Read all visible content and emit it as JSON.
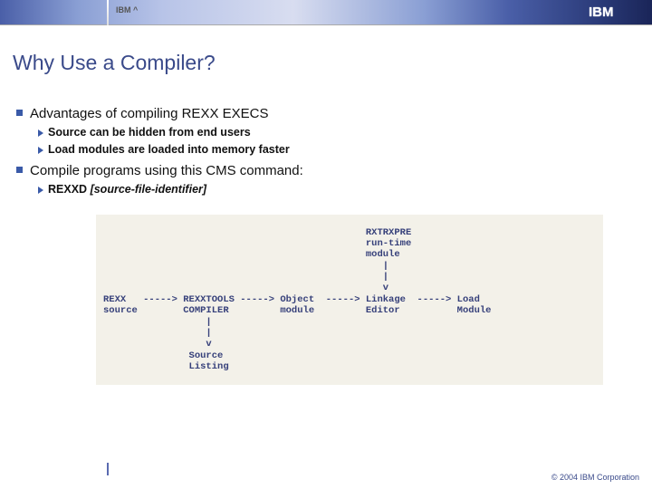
{
  "header": {
    "brand_label": "IBM ^",
    "logo_text": "IBM"
  },
  "title": "Why Use a Compiler?",
  "bullets": [
    {
      "text": "Advantages of compiling REXX EXECS",
      "subs": [
        "Source can be hidden from end users",
        "Load modules are loaded into memory faster"
      ]
    },
    {
      "text": "Compile programs using this CMS command:",
      "subs_cmd": {
        "cmd": "REXXD",
        "arg": "[source-file-identifier]"
      }
    }
  ],
  "diagram": "                                              RXTRXPRE\n                                              run-time\n                                              module\n                                                 |\n                                                 |\n                                                 v\nREXX   -----> REXXTOOLS -----> Object  -----> Linkage  -----> Load\nsource        COMPILER         module         Editor          Module\n                  |\n                  |\n                  v\n               Source\n               Listing",
  "footer": {
    "copyright": "© 2004 IBM Corporation"
  }
}
